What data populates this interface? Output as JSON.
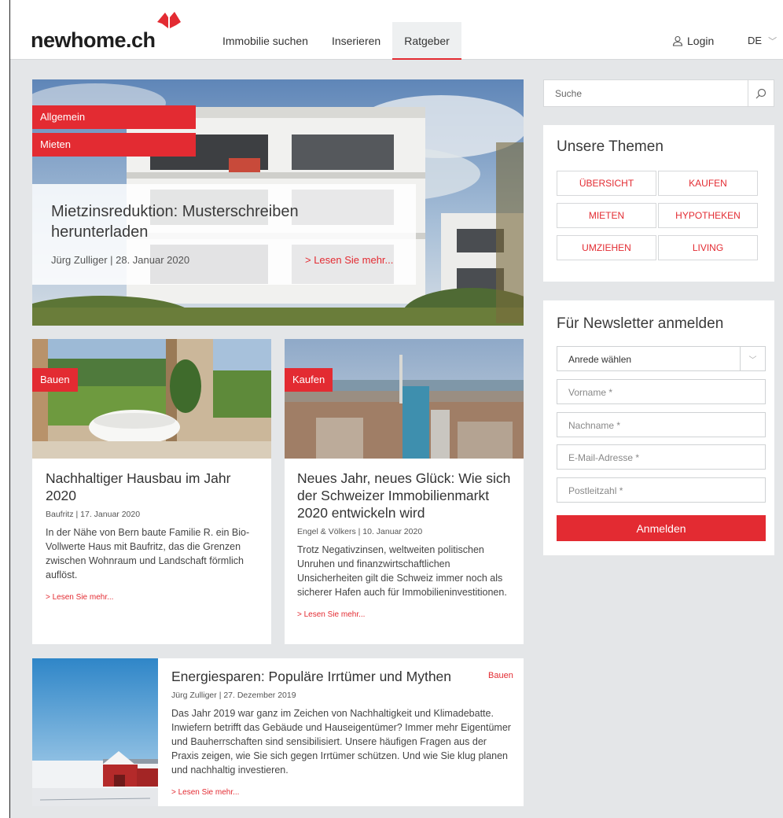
{
  "brand": {
    "logo_text": "newhome.ch",
    "accent": "#e32b32"
  },
  "nav": {
    "items": [
      "Immobilie suchen",
      "Inserieren",
      "Ratgeber"
    ],
    "active": "Ratgeber"
  },
  "header": {
    "login_label": "Login",
    "language": "DE"
  },
  "hero": {
    "badges": [
      "Allgemein",
      "Mieten"
    ],
    "title": "Mietzinsreduktion: Musterschreiben herunterladen",
    "meta": "Jürg Zulliger | 28. Januar 2020",
    "more": "> Lesen Sie mehr..."
  },
  "cards": [
    {
      "badge": "Bauen",
      "title": "Nachhaltiger Hausbau im Jahr 2020",
      "meta": "Baufritz | 17. Januar 2020",
      "text": "In der Nähe von Bern baute Familie R. ein Bio-Vollwerte Haus mit Baufritz, das die Grenzen zwischen Wohnraum und Landschaft förmlich auflöst.",
      "more": "> Lesen Sie mehr..."
    },
    {
      "badge": "Kaufen",
      "title": "Neues Jahr, neues Glück: Wie sich der Schweizer Immobilienmarkt 2020 entwickeln wird",
      "meta": "Engel & Völkers | 10. Januar 2020",
      "text": "Trotz Negativzinsen, weltweiten politischen Unruhen und finanzwirtschaftlichen Unsicherheiten gilt die Schweiz immer noch als sicherer Hafen auch für Immobilieninvestitionen.",
      "more": "> Lesen Sie mehr..."
    },
    {
      "badge": "Bauen",
      "title": "Energiesparen: Populäre Irrtümer und Mythen",
      "meta": "Jürg Zulliger | 27. Dezember 2019",
      "text": "Das Jahr 2019 war ganz im Zeichen von Nachhaltigkeit und Klimadebatte. Inwiefern betrifft das Gebäude und Hauseigentümer? Immer mehr Eigentümer und Bauherrschaften sind sensibilisiert. Unsere häufigen Fragen aus der Praxis zeigen, wie Sie sich gegen Irrtümer schützen. Und wie Sie klug planen und nachhaltig investieren.",
      "more": "> Lesen Sie mehr..."
    }
  ],
  "sidebar": {
    "search_placeholder": "Suche",
    "themes": {
      "title": "Unsere Themen",
      "items": [
        "ÜBERSICHT",
        "KAUFEN",
        "MIETEN",
        "HYPOTHEKEN",
        "UMZIEHEN",
        "LIVING"
      ]
    },
    "newsletter": {
      "title": "Für Newsletter anmelden",
      "salutation": "Anrede wählen",
      "fields": [
        "Vorname *",
        "Nachname *",
        "E-Mail-Adresse *",
        "Postleitzahl *"
      ],
      "submit": "Anmelden"
    }
  }
}
